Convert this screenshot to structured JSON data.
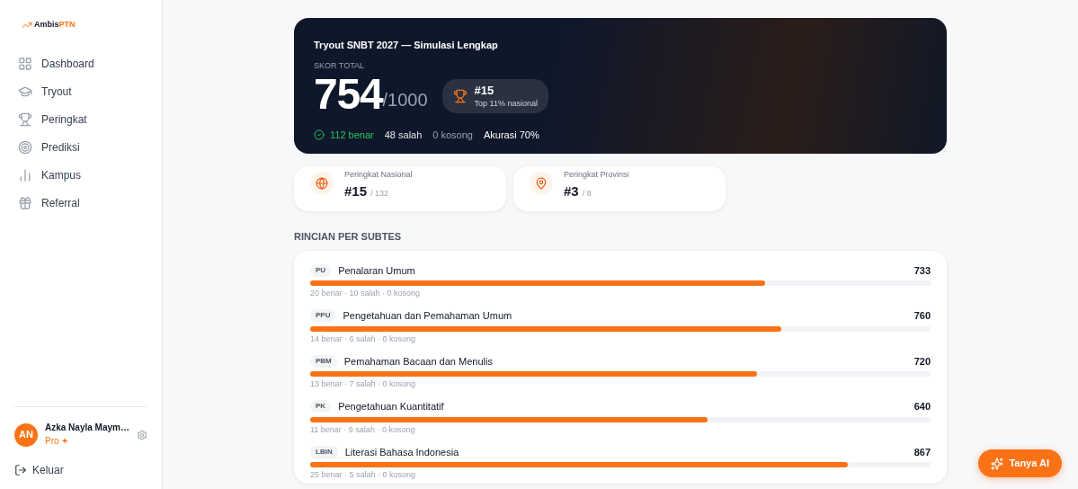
{
  "logo": {
    "brand": "Ambis",
    "accent": "PTN"
  },
  "sidebar": {
    "items": [
      {
        "label": "Dashboard",
        "selected": false
      },
      {
        "label": "Tryout",
        "selected": false
      },
      {
        "label": "Peringkat",
        "selected": false
      },
      {
        "label": "Prediksi",
        "selected": false
      },
      {
        "label": "Kampus",
        "selected": false
      },
      {
        "label": "Referral",
        "selected": false
      }
    ]
  },
  "user": {
    "initials": "AN",
    "name": "Azka Nayla Maym…",
    "plan": "Pro ✦"
  },
  "logout": "Keluar",
  "hero": {
    "title": "Tryout SNBT 2027 — Simulasi Lengkap",
    "score_label": "SKOR TOTAL",
    "score": "754",
    "max": "/1000",
    "rank": "#15",
    "rank_note": "Top 11% nasional",
    "correct": "112 benar",
    "wrong": "48 salah",
    "empty": "0 kosong",
    "accuracy": "Akurasi 70%"
  },
  "rank_cards": [
    {
      "label": "Peringkat Nasional",
      "value": "#15",
      "total": "/ 132"
    },
    {
      "label": "Peringkat Provinsi",
      "value": "#3",
      "total": "/ 8"
    }
  ],
  "section_title": "RINCIAN PER SUBTES",
  "subtests": [
    {
      "code": "PU",
      "name": "Penalaran Umum",
      "score": "733",
      "level": 0.733,
      "stats": "20 benar · 10 salah · 0 kosong"
    },
    {
      "code": "PPU",
      "name": "Pengetahuan dan Pemahaman Umum",
      "score": "760",
      "level": 0.76,
      "stats": "14 benar · 6 salah · 0 kosong"
    },
    {
      "code": "PBM",
      "name": "Pemahaman Bacaan dan Menulis",
      "score": "720",
      "level": 0.72,
      "stats": "13 benar · 7 salah · 0 kosong"
    },
    {
      "code": "PK",
      "name": "Pengetahuan Kuantitatif",
      "score": "640",
      "level": 0.64,
      "stats": "11 benar · 9 salah · 0 kosong"
    },
    {
      "code": "LBIN",
      "name": "Literasi Bahasa Indonesia",
      "score": "867",
      "level": 0.867,
      "stats": "25 benar · 5 salah · 0 kosong"
    }
  ],
  "ai_button": "Tanya AI"
}
